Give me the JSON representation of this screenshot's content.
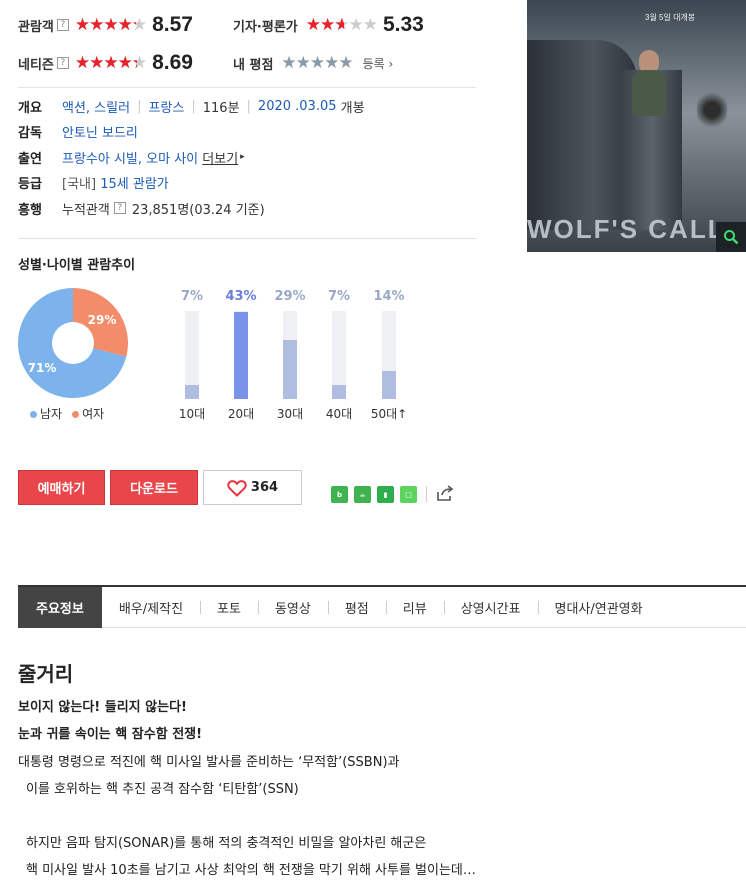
{
  "ratings": {
    "audience": {
      "label": "관람객",
      "score": "8.57",
      "stars": 4.3
    },
    "critic": {
      "label": "기자·평론가",
      "score": "5.33",
      "stars": 2.7
    },
    "netizen": {
      "label": "네티즌",
      "score": "8.69",
      "stars": 4.35
    },
    "mine": {
      "label": "내 평점",
      "action": "등록"
    }
  },
  "info": {
    "overview": {
      "key": "개요",
      "genre": "액션, 스릴러",
      "country": "프랑스",
      "runtime": "116분",
      "release_date": "2020 .03.05",
      "release_suffix": "개봉"
    },
    "director": {
      "key": "감독",
      "value": "안토닌 보드리"
    },
    "cast": {
      "key": "출연",
      "value": "프랑수아 시빌, 오마 사이",
      "more": "더보기"
    },
    "grade": {
      "key": "등급",
      "region": "[국내]",
      "value": "15세 관람가"
    },
    "boxoffice": {
      "key": "흥행",
      "label": "누적관객",
      "value": "23,851명(03.24 기준)"
    }
  },
  "poster": {
    "date_text": "3월 5일 대개봉",
    "title_text": "WOLF'S CALL"
  },
  "stats": {
    "title": "성별·나이별 관람추이",
    "gender": {
      "male_label": "남자",
      "female_label": "여자",
      "male_pct": "71%",
      "female_pct": "29%",
      "male_value": 71,
      "female_value": 29,
      "male_color": "#7cb3ec",
      "female_color": "#f28c6b"
    },
    "ages": [
      {
        "label": "10대",
        "pct": "7%",
        "value": 7
      },
      {
        "label": "20대",
        "pct": "43%",
        "value": 43
      },
      {
        "label": "30대",
        "pct": "29%",
        "value": 29
      },
      {
        "label": "40대",
        "pct": "7%",
        "value": 7
      },
      {
        "label": "50대",
        "pct": "14%",
        "value": 14
      }
    ]
  },
  "actions": {
    "reserve": "예매하기",
    "download": "다운로드",
    "like_count": "364"
  },
  "tabs": [
    "주요정보",
    "배우/제작진",
    "포토",
    "동영상",
    "평점",
    "리뷰",
    "상영시간표",
    "명대사/연관영화"
  ],
  "plot": {
    "title": "줄거리",
    "lines": [
      "보이지 않는다! 들리지 않는다!",
      "눈과 귀를 속이는 핵 잠수함 전쟁!",
      "대통령 명령으로 적진에 핵 미사일 발사를 준비하는 ‘무적함’(SSBN)과",
      "이를 호위하는 핵 추진 공격 잠수함 ‘티탄함’(SSN)",
      "하지만 음파 탐지(SONAR)를 통해 적의 충격적인 비밀을 알아차린 해군은",
      "핵 미사일 발사 10초를 남기고 사상 최악의 핵 전쟁을 막기 위해 사투를 벌이는데…"
    ]
  }
}
